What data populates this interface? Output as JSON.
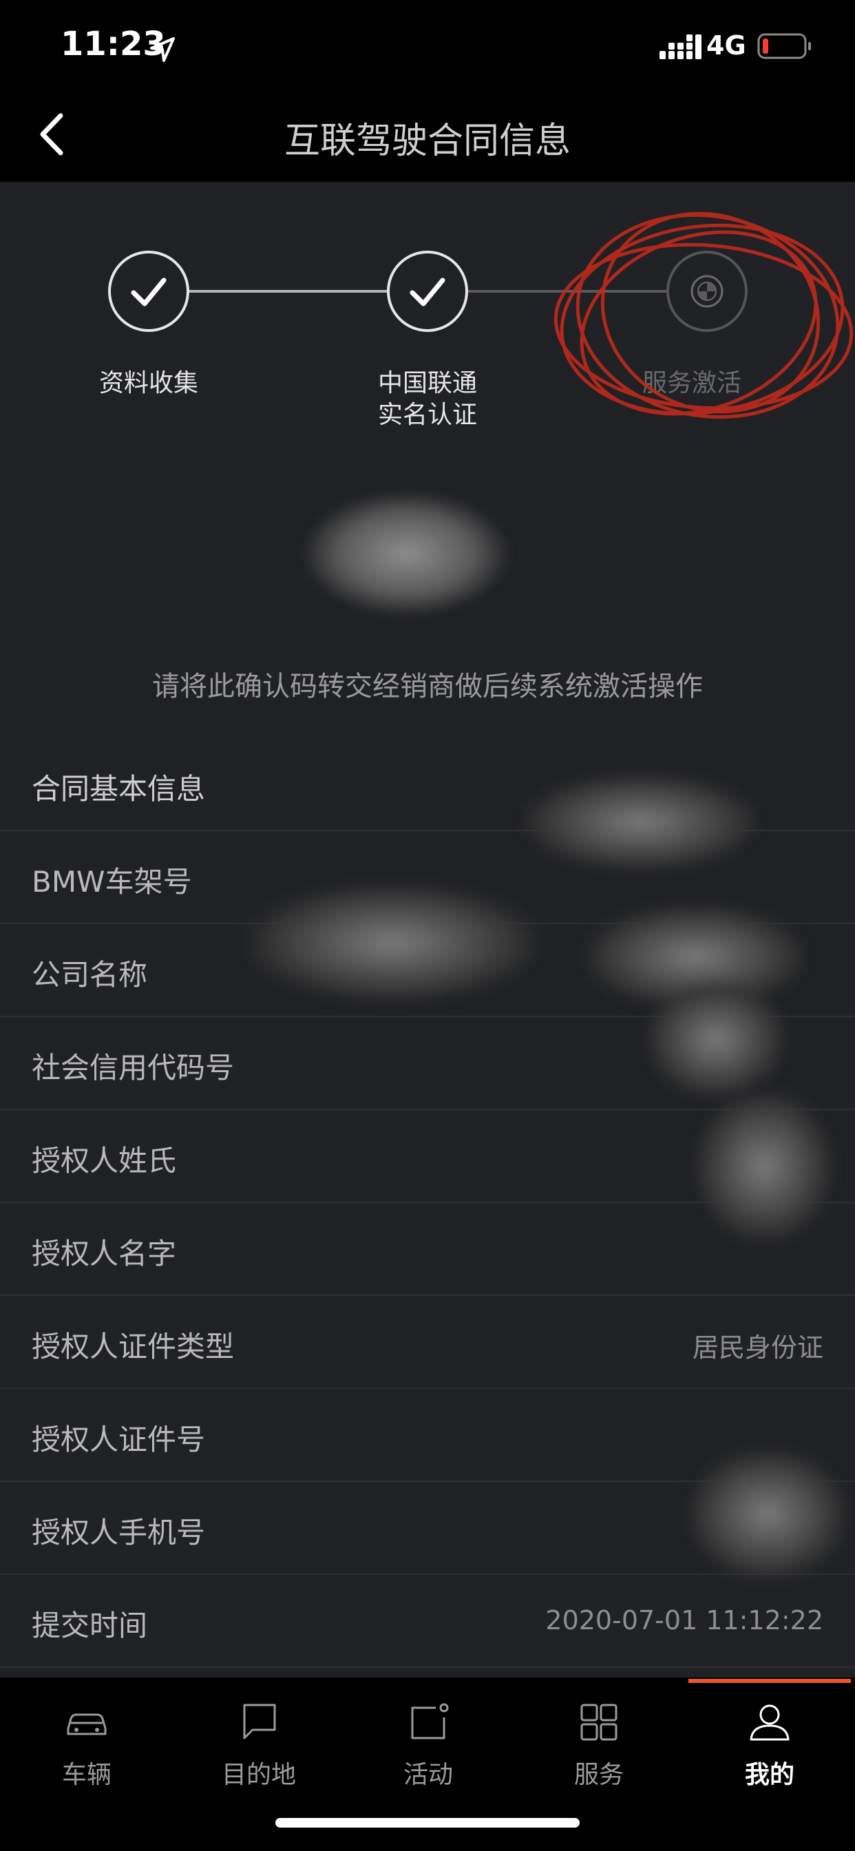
{
  "status_bar": {
    "time": "11:23",
    "network": "4G"
  },
  "nav": {
    "title": "互联驾驶合同信息"
  },
  "stepper": {
    "steps": [
      {
        "label": "资料收集",
        "state": "done"
      },
      {
        "label": "中国联通\n实名认证",
        "state": "done"
      },
      {
        "label": "服务激活",
        "state": "pending"
      }
    ]
  },
  "confirm": {
    "hint": "请将此确认码转交经销商做后续系统激活操作"
  },
  "contract": {
    "section_title": "合同基本信息",
    "rows": [
      {
        "label": "BMW车架号",
        "value": ""
      },
      {
        "label": "公司名称",
        "value": ""
      },
      {
        "label": "社会信用代码号",
        "value": ""
      },
      {
        "label": "授权人姓氏",
        "value": ""
      },
      {
        "label": "授权人名字",
        "value": ""
      },
      {
        "label": "授权人证件类型",
        "value": "居民身份证"
      },
      {
        "label": "授权人证件号",
        "value": ""
      },
      {
        "label": "授权人手机号",
        "value": ""
      },
      {
        "label": "提交时间",
        "value": "2020-07-01 11:12:22"
      }
    ]
  },
  "tabs": [
    {
      "label": "车辆",
      "icon": "car-icon"
    },
    {
      "label": "目的地",
      "icon": "chat-bubble-icon"
    },
    {
      "label": "活动",
      "icon": "activity-icon"
    },
    {
      "label": "服务",
      "icon": "grid-icon"
    },
    {
      "label": "我的",
      "icon": "user-icon",
      "active": true
    }
  ],
  "colors": {
    "accent": "#e8562a",
    "background": "#202124",
    "scribble": "#c0291c"
  }
}
